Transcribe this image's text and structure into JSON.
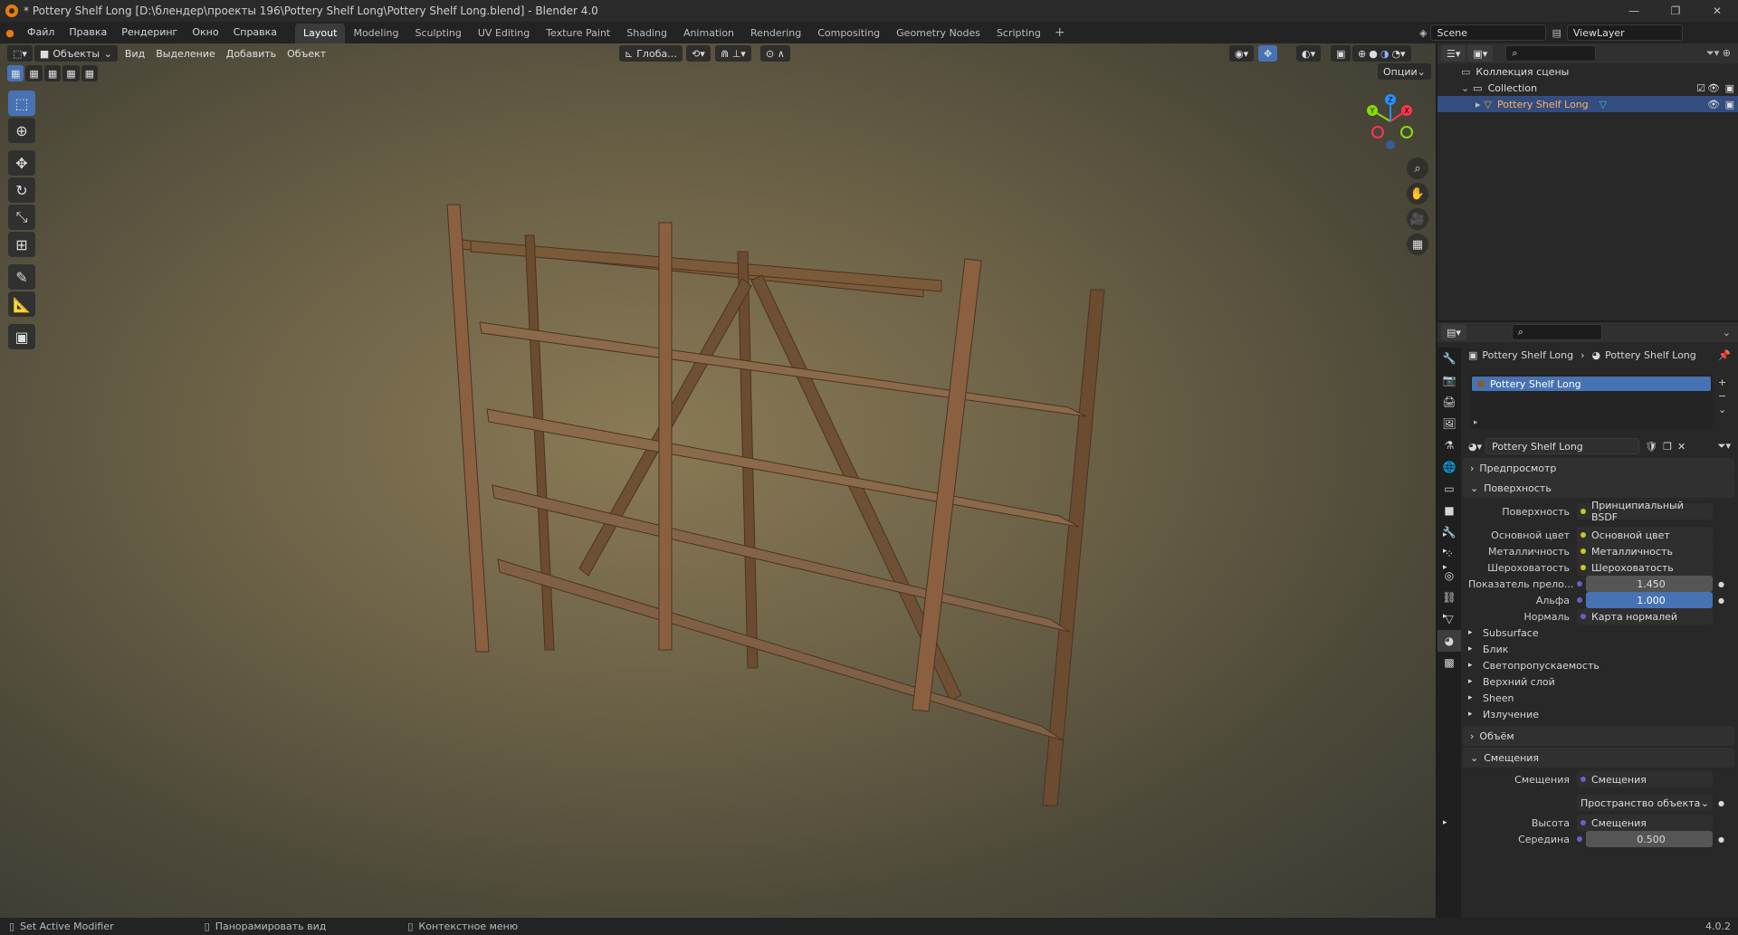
{
  "window": {
    "title": "* Pottery Shelf Long [D:\\блендер\\проекты 196\\Pottery Shelf Long\\Pottery Shelf Long.blend] - Blender 4.0",
    "minimize": "—",
    "maximize": "❐",
    "close": "✕"
  },
  "menu": {
    "items": [
      "Файл",
      "Правка",
      "Рендеринг",
      "Окно",
      "Справка"
    ]
  },
  "workspaces": {
    "tabs": [
      "Layout",
      "Modeling",
      "Sculpting",
      "UV Editing",
      "Texture Paint",
      "Shading",
      "Animation",
      "Rendering",
      "Compositing",
      "Geometry Nodes",
      "Scripting"
    ],
    "active": "Layout",
    "add": "+"
  },
  "top_right": {
    "scene": "Scene",
    "view_layer": "ViewLayer"
  },
  "viewport": {
    "mode": "Объекты",
    "menus": [
      "Вид",
      "Выделение",
      "Добавить",
      "Объект"
    ],
    "transform_orientation": "Глоба...",
    "options": "Опции",
    "gizmo_labels": {
      "x": "X",
      "y": "Y",
      "z": "Z"
    }
  },
  "outliner": {
    "root": "Коллекция сцены",
    "collection": "Collection",
    "object": "Pottery Shelf Long"
  },
  "properties": {
    "breadcrumb_object": "Pottery Shelf Long",
    "breadcrumb_material": "Pottery Shelf Long",
    "slot": "Pottery Shelf Long",
    "material_name": "Pottery Shelf Long",
    "panels": {
      "preview": "Предпросмотр",
      "surface": "Поверхность",
      "volume": "Объём",
      "displacement": "Смещения"
    },
    "surface_rows": [
      {
        "label": "Поверхность",
        "value": "Принципиальный BSDF",
        "dot": "g",
        "expand": false
      },
      {
        "label": "Основной цвет",
        "value": "Основной цвет",
        "dot": "g",
        "expand": true
      },
      {
        "label": "Металличность",
        "value": "Металличность",
        "dot": "g",
        "expand": true
      },
      {
        "label": "Шероховатость",
        "value": "Шероховатость",
        "dot": "g",
        "expand": true
      }
    ],
    "ior": {
      "label": "Показатель прело...",
      "value": "1.450"
    },
    "alpha": {
      "label": "Альфа",
      "value": "1.000"
    },
    "normal": {
      "label": "Нормаль",
      "value": "Карта нормалей"
    },
    "subpanels": [
      "Subsurface",
      "Блик",
      "Светопропускаемость",
      "Верхний слой",
      "Sheen",
      "Излучение"
    ],
    "disp_label": "Смещения",
    "disp_value": "Смещения",
    "space": "Пространство объекта",
    "height_label": "Высота",
    "height_value": "Смещения",
    "midlevel_label": "Середина",
    "midlevel_value": "0.500"
  },
  "status": {
    "left": "Set Active Modifier",
    "middle": "Панорамировать вид",
    "right": "Контекстное меню",
    "version": "4.0.2"
  }
}
